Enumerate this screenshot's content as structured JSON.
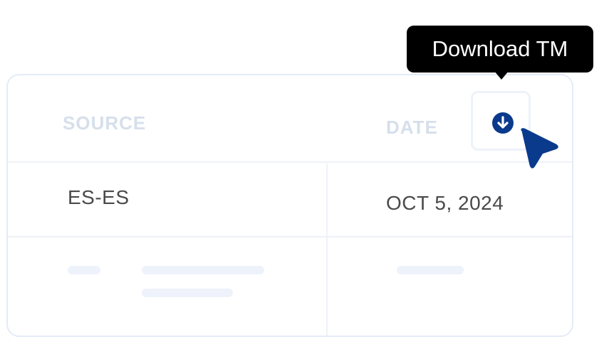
{
  "table": {
    "headers": {
      "source": "SOURCE",
      "date": "DATE"
    },
    "rows": [
      {
        "source": "ES-ES",
        "date": "OCT 5, 2024"
      }
    ]
  },
  "tooltip": {
    "label": "Download TM"
  },
  "icons": {
    "download": "arrow-down-circle-icon",
    "cursor": "pointer-cursor-icon"
  },
  "colors": {
    "accent": "#0a3a8c",
    "header_text": "#d6dfeb",
    "border": "#e4ebf7",
    "tooltip_bg": "#000000"
  }
}
